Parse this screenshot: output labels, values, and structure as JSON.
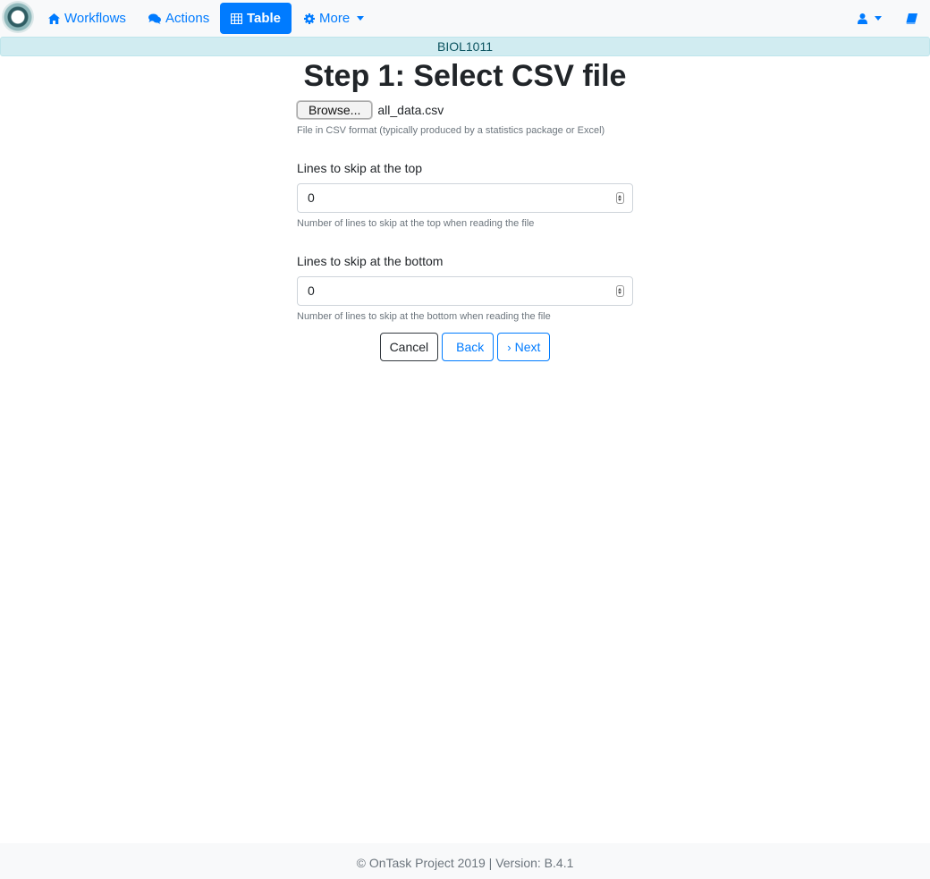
{
  "nav": {
    "items": [
      {
        "label": "Workflows",
        "icon": "home-icon"
      },
      {
        "label": "Actions",
        "icon": "comments-icon"
      },
      {
        "label": "Table",
        "icon": "table-icon",
        "active": true
      },
      {
        "label": "More",
        "icon": "gear-icon"
      }
    ],
    "user_icon": "user-icon",
    "book_icon": "book-icon"
  },
  "workflow": {
    "name": "BIOL1011"
  },
  "page": {
    "title": "Step 1: Select CSV file"
  },
  "file": {
    "browse_label": "Browse...",
    "selected_file": "all_data.csv",
    "help": "File in CSV format (typically produced by a statistics package or Excel)"
  },
  "skip_top": {
    "label": "Lines to skip at the top",
    "value": "0",
    "help": "Number of lines to skip at the top when reading the file"
  },
  "skip_bottom": {
    "label": "Lines to skip at the bottom",
    "value": "0",
    "help": "Number of lines to skip at the bottom when reading the file"
  },
  "actions": {
    "cancel": "Cancel",
    "back": "Back",
    "next": "Next",
    "next_icon": "chevron-right-icon"
  },
  "footer": {
    "text": "© OnTask Project 2019 | Version: B.4.1"
  },
  "colors": {
    "primary": "#007bff",
    "banner_bg": "#d1ecf1",
    "navbar_bg": "#f8f9fa"
  }
}
